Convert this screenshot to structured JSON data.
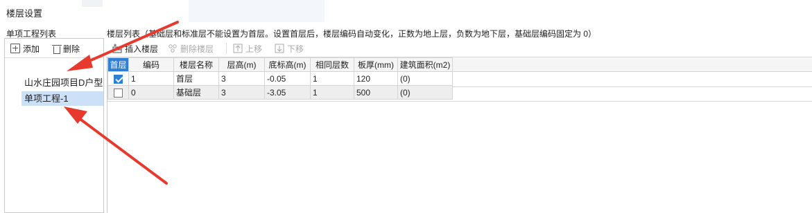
{
  "window": {
    "title": "楼层设置"
  },
  "left": {
    "header": "单项工程列表",
    "toolbar": {
      "add_label": "添加",
      "delete_label": "删除"
    },
    "tree": [
      {
        "label": "山水庄园项目D户型-栋"
      },
      {
        "label": "单项工程-1",
        "selected": true
      }
    ]
  },
  "right": {
    "header": "楼层列表（基础层和标准层不能设置为首层。设置首层后，楼层编码自动变化，正数为地上层，负数为地下层，基础层编码固定为 0）",
    "toolbar": {
      "insert_label": "插入楼层",
      "delete_label": "删除楼层",
      "up_label": "上移",
      "down_label": "下移"
    },
    "columns": [
      "首层",
      "编码",
      "楼层名称",
      "层高(m)",
      "底标高(m)",
      "相同层数",
      "板厚(mm)",
      "建筑面积(m2)"
    ],
    "rows": [
      {
        "first": true,
        "code": "1",
        "name": "首层",
        "height": "3",
        "bottom": "-0.05",
        "same": "1",
        "thick": "120",
        "area": "(0)"
      },
      {
        "first": false,
        "code": "0",
        "name": "基础层",
        "height": "3",
        "bottom": "-3.05",
        "same": "1",
        "thick": "500",
        "area": "(0)"
      }
    ]
  },
  "colors": {
    "accent": "#2f7fd5",
    "selection": "#cce0f7",
    "annotation_arrow": "#e8392f"
  }
}
